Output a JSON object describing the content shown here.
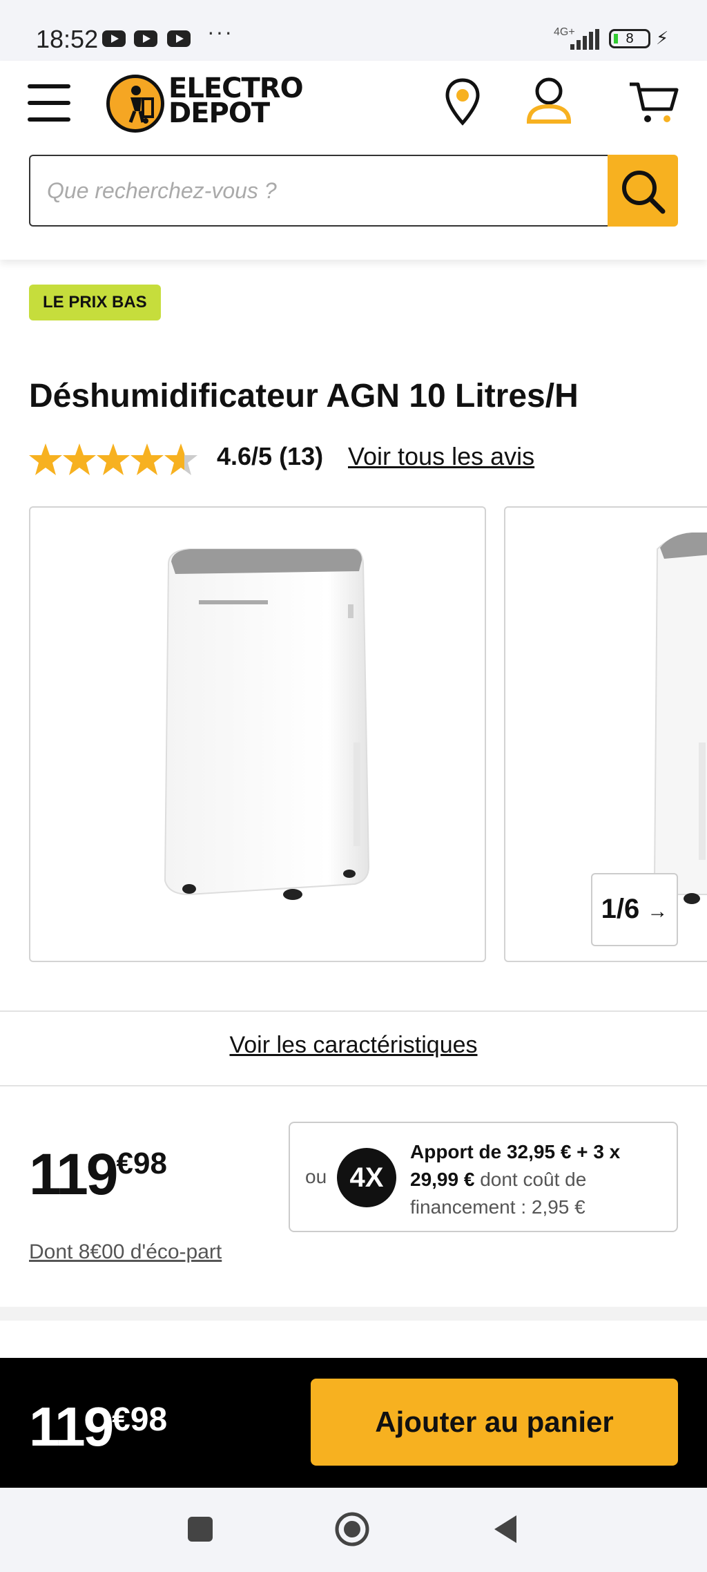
{
  "status_bar": {
    "time": "18:52",
    "dots": "···",
    "network": "4G+",
    "battery": "8"
  },
  "header": {
    "logo_line1": "ELECTRO",
    "logo_line2": "DEPOT",
    "search_placeholder": "Que recherchez-vous ?"
  },
  "product": {
    "badge": "LE PRIX BAS",
    "title": "Déshumidificateur AGN 10 Litres/H",
    "rating_value": 4.6,
    "rating_text": "4.6/5 (13)",
    "reviews_link": "Voir tous les avis",
    "image_pager": "1/6",
    "characteristics_link": "Voir les caractéristiques"
  },
  "price": {
    "integer": "119",
    "decimals": "€98",
    "eco_part": "Dont 8€00 d'éco-part"
  },
  "financing": {
    "or_label": "ou",
    "badge": "4X",
    "text_bold": "Apport de 32,95 € + 3 x 29,99 €",
    "text_regular": " dont coût de financement : 2,95 €"
  },
  "sticky": {
    "price_integer": "119",
    "price_decimals": "€98",
    "add_to_cart": "Ajouter au panier"
  },
  "colors": {
    "accent": "#f7b120",
    "badge_green": "#c6dd3c",
    "sticky_bg": "#000000"
  }
}
